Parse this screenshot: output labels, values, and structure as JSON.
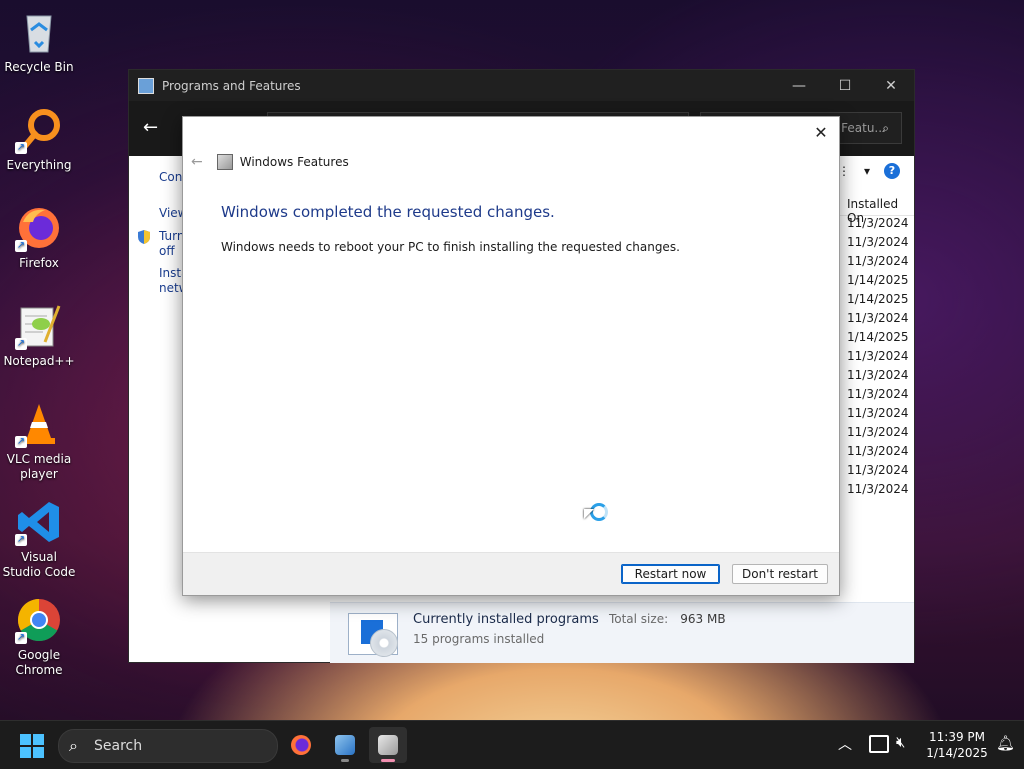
{
  "desktop": {
    "icons": [
      {
        "label": "Recycle Bin"
      },
      {
        "label": "Everything"
      },
      {
        "label": "Firefox"
      },
      {
        "label": "Notepad++"
      },
      {
        "label": "VLC media player"
      },
      {
        "label": "Visual Studio Code"
      },
      {
        "label": "Google Chrome"
      }
    ]
  },
  "programs_window": {
    "title": "Programs and Features",
    "search_placeholder": "Search Programs and Featu...",
    "left_links": [
      "Cont",
      "View",
      "Turn",
      "off",
      "Instal",
      "netw"
    ],
    "column_header": "Installed On",
    "installed_dates": [
      "11/3/2024",
      "11/3/2024",
      "11/3/2024",
      "1/14/2025",
      "1/14/2025",
      "11/3/2024",
      "1/14/2025",
      "11/3/2024",
      "11/3/2024",
      "11/3/2024",
      "11/3/2024",
      "11/3/2024",
      "11/3/2024",
      "11/3/2024",
      "11/3/2024"
    ],
    "status": {
      "title": "Currently installed programs",
      "total_label": "Total size:",
      "total_value": "963 MB",
      "count": "15 programs installed"
    }
  },
  "features_dialog": {
    "title": "Windows Features",
    "heading": "Windows completed the requested changes.",
    "message": "Windows needs to reboot your PC to finish installing the requested changes.",
    "restart_label": "Restart now",
    "dont_restart_label": "Don't restart"
  },
  "taskbar": {
    "search_label": "Search",
    "time": "11:39 PM",
    "date": "1/14/2025"
  },
  "colors": {
    "accent": "#0a64c8",
    "heading": "#1e3a8a",
    "start": "#4cc2ff"
  }
}
